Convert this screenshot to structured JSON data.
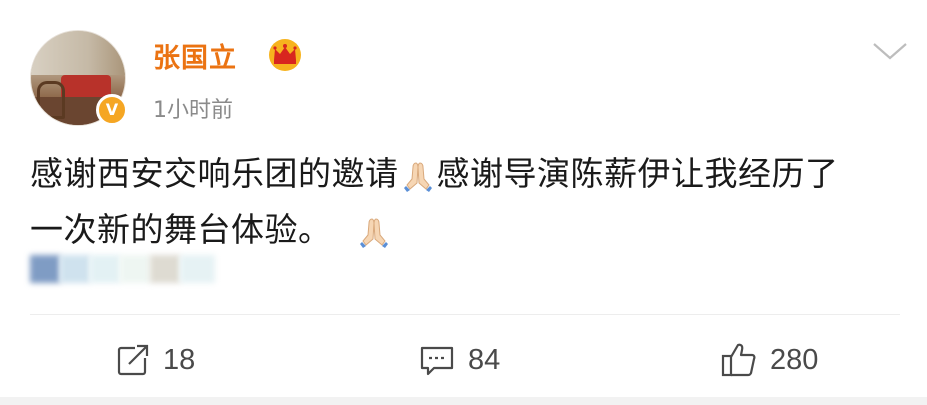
{
  "post": {
    "author": {
      "name": "张国立",
      "verified": true,
      "verified_badge_letter": "V"
    },
    "timestamp": "1小时前",
    "content": {
      "line1_part1": "感谢西安交响乐团的邀请",
      "line1_part2": "感谢导演陈薪伊让我经历了",
      "line2": "一次新的舞台体验。"
    },
    "actions": {
      "repost": {
        "icon": "share-icon",
        "count": "18"
      },
      "comment": {
        "icon": "comment-icon",
        "count": "84"
      },
      "like": {
        "icon": "thumbs-up-icon",
        "count": "280"
      }
    }
  },
  "colors": {
    "username": "#eb7312",
    "verified_badge": "#f5a623",
    "text": "#1a1a1a",
    "meta": "#8a8a8a",
    "icon": "#4a4a4a",
    "divider": "#ededed"
  },
  "icons": {
    "more": "chevron-down-icon",
    "crown": "crown-icon",
    "prayer": "folded-hands-emoji"
  }
}
